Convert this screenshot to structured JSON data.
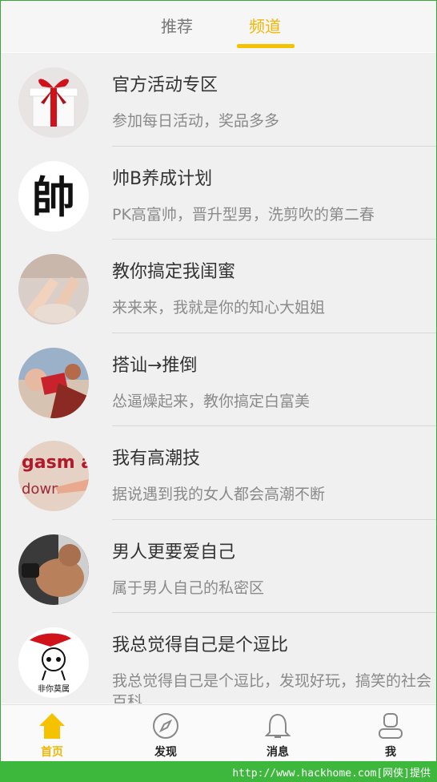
{
  "top_tabs": {
    "recommend": "推荐",
    "channel": "频道"
  },
  "channels": [
    {
      "title": "官方活动专区",
      "subtitle": "参加每日活动，奖品多多"
    },
    {
      "title": "帅B养成计划",
      "subtitle": "PK高富帅，晋升型男，洗剪吹的第二春",
      "avatar_text": "帥"
    },
    {
      "title": "教你搞定我闺蜜",
      "subtitle": "来来来，我就是你的知心大姐姐"
    },
    {
      "title": "搭讪→推倒",
      "subtitle": "怂逼燥起来，教你搞定白富美"
    },
    {
      "title": "我有高潮技",
      "subtitle": "据说遇到我的女人都会高潮不断",
      "avatar_text_1": "gasm ag",
      "avatar_text_2": "down"
    },
    {
      "title": "男人更要爱自己",
      "subtitle": "属于男人自己的私密区"
    },
    {
      "title": "我总觉得自己是个逗比",
      "subtitle": "我总觉得自己是个逗比，发现好玩，搞笑的社会百科",
      "avatar_text": "非你莫属"
    }
  ],
  "bottom_nav": {
    "home": "首页",
    "discover": "发现",
    "messages": "消息",
    "me": "我"
  },
  "footer": {
    "text": "http://www.hackhome.com[网侠]提供"
  },
  "colors": {
    "accent": "#f5c200",
    "footer": "#3db83d"
  }
}
